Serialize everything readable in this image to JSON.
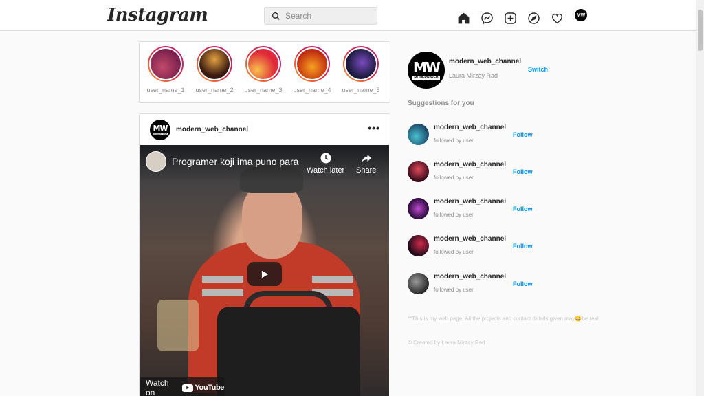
{
  "header": {
    "logo": "Instagram",
    "search_placeholder": "Search",
    "nav_icons": [
      "home-icon",
      "messenger-icon",
      "new-post-icon",
      "explore-icon",
      "activity-heart-icon",
      "profile-avatar-icon"
    ],
    "avatar_label": "MW"
  },
  "stories": [
    {
      "name": "user_name_1",
      "colors": [
        "#7a1f4d",
        "#c04a6a"
      ]
    },
    {
      "name": "user_name_2",
      "colors": [
        "#3a1a10",
        "#e0a040"
      ]
    },
    {
      "name": "user_name_3",
      "colors": [
        "#e02a3a",
        "#f7c04a"
      ]
    },
    {
      "name": "user_name_4",
      "colors": [
        "#c02a10",
        "#f7a020"
      ]
    },
    {
      "name": "user_name_5",
      "colors": [
        "#1a1a3a",
        "#7a4ac0"
      ]
    }
  ],
  "post": {
    "username": "modern_web_channel",
    "avatar": {
      "main": "MW",
      "sub": "MODERN WEB"
    },
    "more": "•••",
    "video": {
      "title": "Programer koji ima puno para",
      "watch_later": "Watch later",
      "share": "Share",
      "watch_on": "Watch on",
      "youtube": "YouTube"
    }
  },
  "sidebar": {
    "username": "modern_web_channel",
    "full_name": "Laura Mirzay Rad",
    "switch_label": "Switch",
    "avatar": {
      "main": "MW",
      "sub": "MODERN WEB"
    },
    "suggestions_title": "Suggestions for you",
    "suggestions": [
      {
        "username": "modern_web_channel",
        "subtitle": "followed by user",
        "follow": "Follow",
        "colors": [
          "#1a4a6a",
          "#4ac0d0"
        ]
      },
      {
        "username": "modern_web_channel",
        "subtitle": "followed by user",
        "follow": "Follow",
        "colors": [
          "#3a0a1a",
          "#e04a5a"
        ]
      },
      {
        "username": "modern_web_channel",
        "subtitle": "followed by user",
        "follow": "Follow",
        "colors": [
          "#2a0a3a",
          "#c04ad0"
        ]
      },
      {
        "username": "modern_web_channel",
        "subtitle": "followed by user",
        "follow": "Follow",
        "colors": [
          "#1a0a1a",
          "#d02a4a"
        ]
      },
      {
        "username": "modern_web_channel",
        "subtitle": "followed by user",
        "follow": "Follow",
        "colors": [
          "#2a2a2a",
          "#9a9a9a"
        ]
      }
    ],
    "note": "**This is my web page. All the projects and contact details given may😀be real.",
    "copyright": "© Created by Laura Mirzay Rad"
  }
}
